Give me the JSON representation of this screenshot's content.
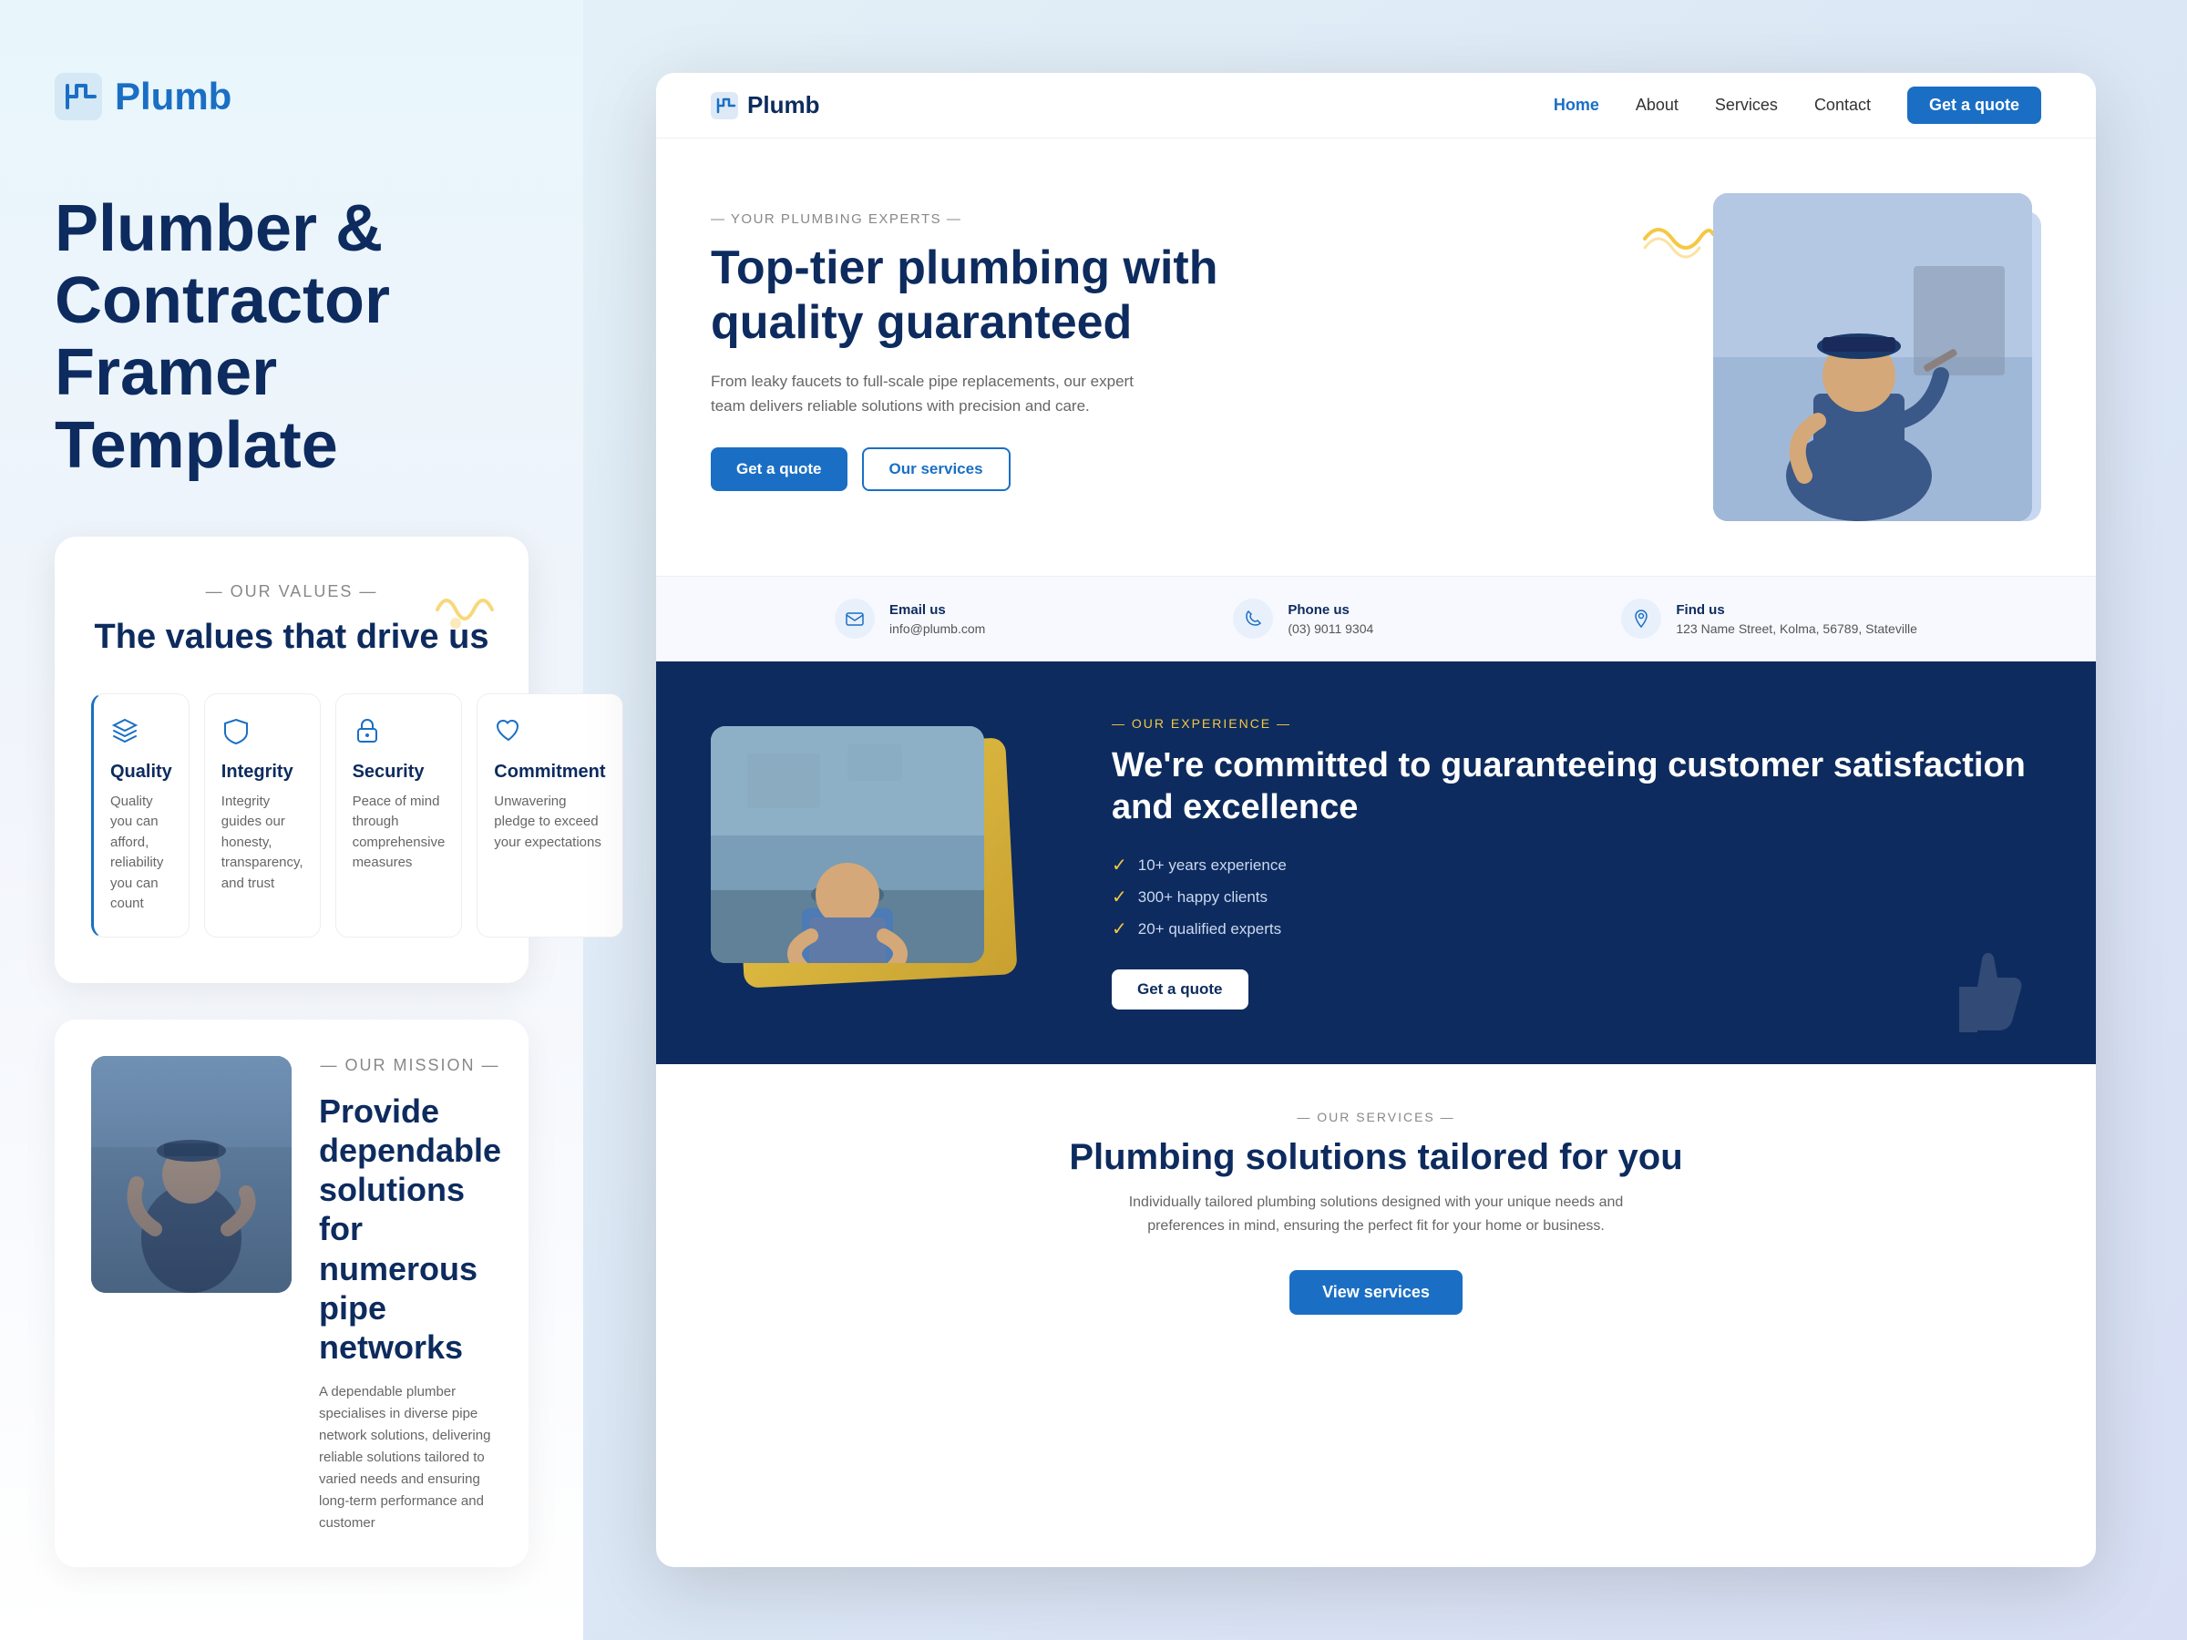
{
  "left": {
    "logo_text": "Plumb",
    "headline": "Plumber & Contractor Framer Template",
    "values_section_label": "— OUR VALUES —",
    "values_title": "The values that drive us",
    "values": [
      {
        "id": "quality",
        "icon": "layers-icon",
        "name": "Quality",
        "desc": "Quality you can afford, reliability you can count"
      },
      {
        "id": "integrity",
        "icon": "shield-icon",
        "name": "Integrity",
        "desc": "Integrity guides our honesty, transparency, and trust"
      },
      {
        "id": "security",
        "icon": "lock-icon",
        "name": "Security",
        "desc": "Peace of mind through comprehensive measures"
      },
      {
        "id": "commitment",
        "icon": "heart-icon",
        "name": "Commitment",
        "desc": "Unwavering pledge to exceed your expectations"
      }
    ],
    "mission_label": "— OUR MISSION —",
    "mission_title": "Provide dependable solutions for numerous pipe networks",
    "mission_desc": "A dependable plumber specialises in diverse pipe network solutions, delivering reliable solutions tailored to varied needs and ensuring long-term performance and customer"
  },
  "site": {
    "logo_text": "Plumb",
    "nav": {
      "links": [
        {
          "label": "Home",
          "active": true
        },
        {
          "label": "About",
          "active": false
        },
        {
          "label": "Services",
          "active": false
        },
        {
          "label": "Contact",
          "active": false
        }
      ],
      "cta_label": "Get a quote"
    },
    "hero": {
      "tag": "— YOUR PLUMBING EXPERTS —",
      "title": "Top-tier plumbing  with quality guaranteed",
      "desc": "From leaky faucets to full-scale pipe replacements, our expert team delivers reliable solutions with precision and care.",
      "btn_primary": "Get a quote",
      "btn_secondary": "Our services"
    },
    "contacts": [
      {
        "label": "Email us",
        "value": "info@plumb.com",
        "icon": "email-icon"
      },
      {
        "label": "Phone us",
        "value": "(03) 9011 9304",
        "icon": "phone-icon"
      },
      {
        "label": "Find us",
        "value": "123 Name Street, Kolma, 56789, Stateville",
        "icon": "location-icon"
      }
    ],
    "experience": {
      "tag": "— OUR EXPERIENCE —",
      "title": "We're committed to guaranteeing customer satisfaction and excellence",
      "stats": [
        "10+ years experience",
        "300+ happy clients",
        "20+ qualified experts"
      ],
      "cta_label": "Get a quote"
    },
    "services": {
      "tag": "— OUR SERVICES —",
      "title": "Plumbing solutions tailored for you",
      "desc": "Individually tailored plumbing solutions designed with your unique needs and preferences in mind, ensuring the perfect fit for your home or business.",
      "cta_label": "View services"
    }
  }
}
